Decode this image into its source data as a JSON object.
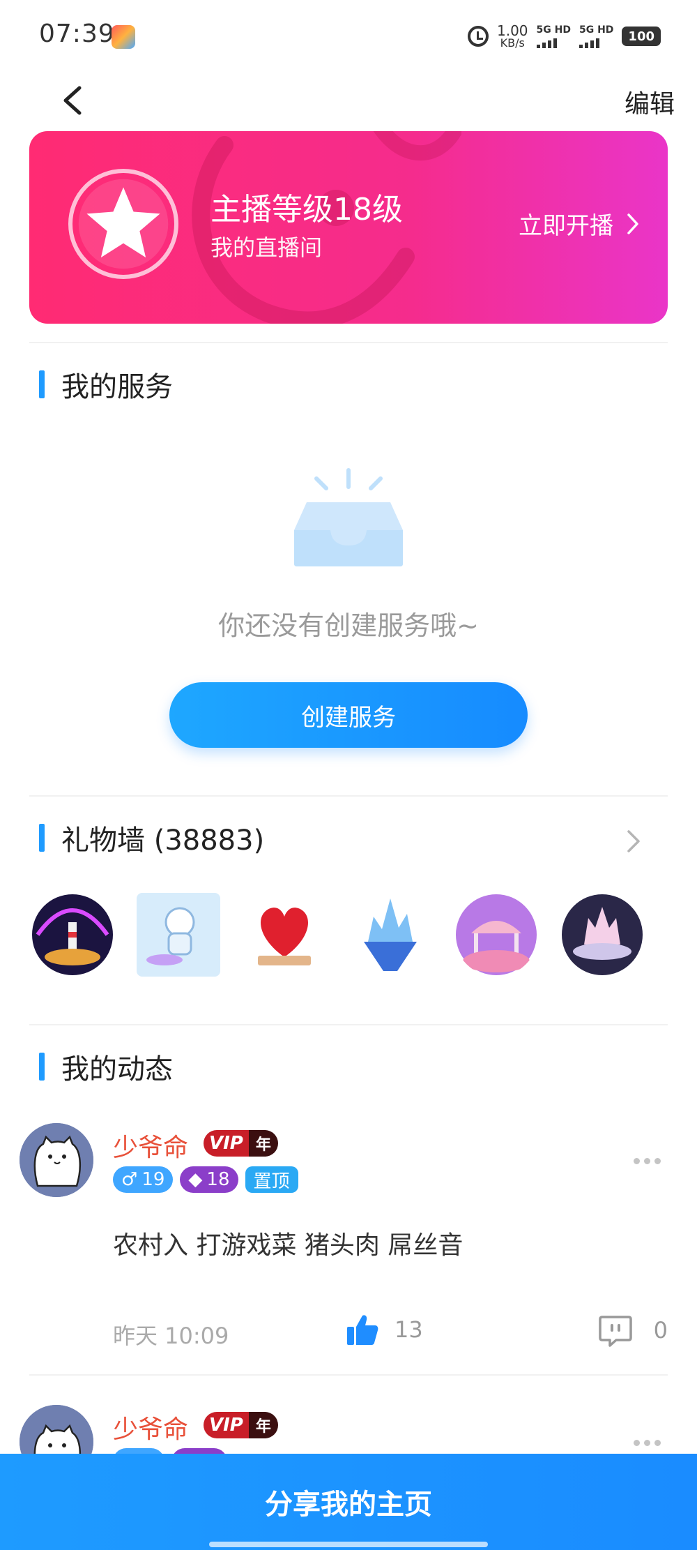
{
  "status_bar": {
    "time": "07:39",
    "net_speed_value": "1.00",
    "net_speed_unit": "KB/s",
    "sim1": "5G HD",
    "sim2": "5G HD",
    "battery": "100"
  },
  "header": {
    "edit_label": "编辑"
  },
  "anchor_banner": {
    "title": "主播等级18级",
    "subtitle": "我的直播间",
    "cta": "立即开播",
    "colors": {
      "start": "#ff2b73",
      "end": "#ea35c8"
    }
  },
  "services": {
    "title": "我的服务",
    "empty_text": "你还没有创建服务哦~",
    "create_label": "创建服务"
  },
  "gift_wall": {
    "title": "礼物墙 (38883)",
    "gifts": [
      "lighthouse-gift",
      "astronaut-gift",
      "rose-heart-gift",
      "ice-castle-gift",
      "flower-gazebo-gift",
      "dream-castle-gift"
    ]
  },
  "moments": {
    "title": "我的动态",
    "posts": [
      {
        "name": "少爷命",
        "vip": "VIP",
        "vip_period": "年",
        "gender_age": "19",
        "level": "18",
        "pin": "置顶",
        "content": "农村入 打游戏菜 猪头肉 屌丝音",
        "time": "昨天 10:09",
        "likes": "13",
        "comments": "0"
      },
      {
        "name": "少爷命",
        "vip": "VIP",
        "vip_period": "年"
      }
    ]
  },
  "share_label": "分享我的主页",
  "accent_color": "#1f9bff"
}
